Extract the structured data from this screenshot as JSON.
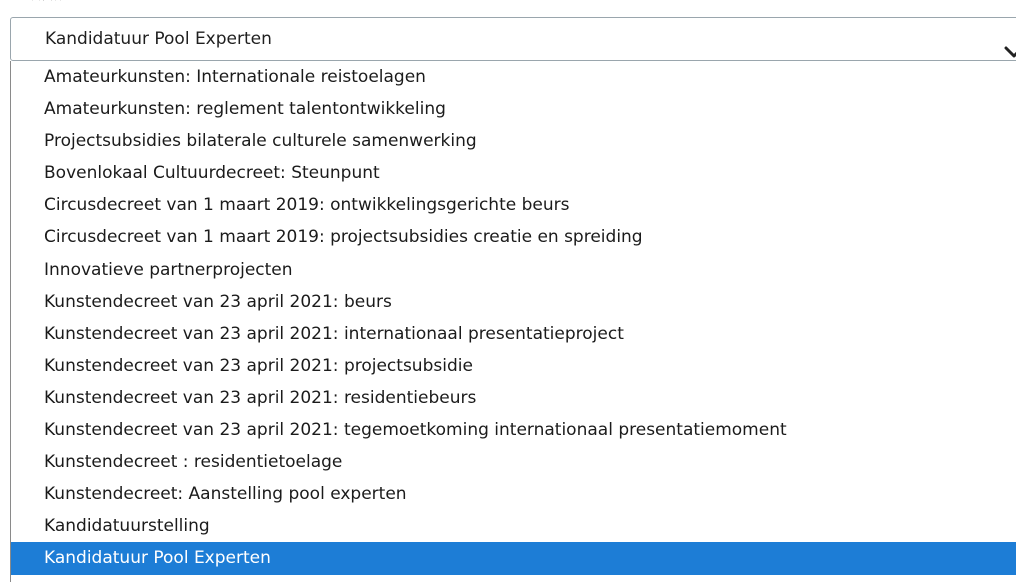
{
  "select": {
    "value": "Kandidatuur Pool Experten",
    "icon": "chevron-down-icon",
    "options": [
      "Amateurkunsten: Internationale reistoelagen",
      "Amateurkunsten: reglement talentontwikkeling",
      "Projectsubsidies bilaterale culturele samenwerking",
      "Bovenlokaal Cultuurdecreet: Steunpunt",
      "Circusdecreet van 1 maart 2019: ontwikkelingsgerichte beurs",
      "Circusdecreet van 1 maart 2019: projectsubsidies creatie en spreiding",
      "Innovatieve partnerprojecten",
      "Kunstendecreet van 23 april 2021: beurs",
      "Kunstendecreet van 23 april 2021: internationaal presentatieproject",
      "Kunstendecreet van 23 april 2021: projectsubsidie",
      "Kunstendecreet van 23 april 2021: residentiebeurs",
      "Kunstendecreet van 23 april 2021: tegemoetkoming internationaal presentatiemoment",
      "Kunstendecreet : residentietoelage",
      "Kunstendecreet: Aanstelling pool experten",
      "Kandidatuurstelling",
      "Kandidatuur Pool Experten"
    ],
    "selected_index": 15
  },
  "colors": {
    "selected_background": "#1d7dd6",
    "selected_text": "#ffffff",
    "border": "#9aa6ad"
  }
}
